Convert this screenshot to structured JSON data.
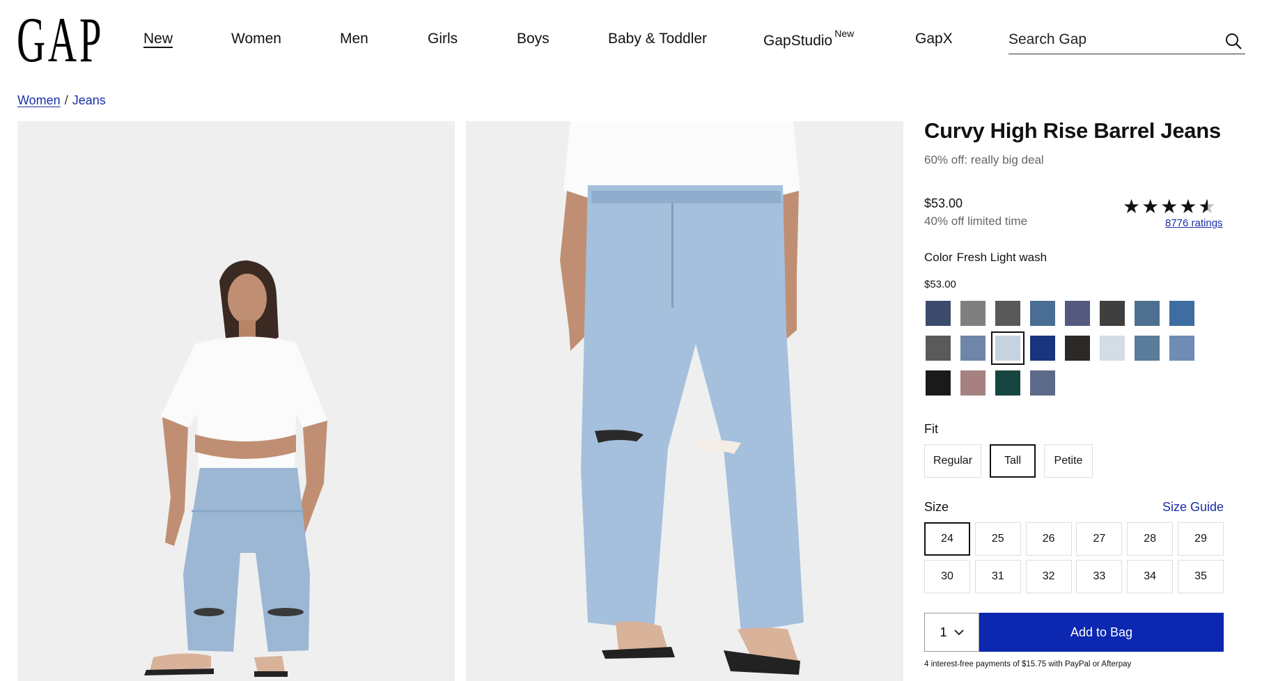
{
  "header": {
    "logo": "GAP",
    "nav": [
      {
        "label": "New",
        "active": true
      },
      {
        "label": "Women"
      },
      {
        "label": "Men"
      },
      {
        "label": "Girls"
      },
      {
        "label": "Boys"
      },
      {
        "label": "Baby & Toddler"
      },
      {
        "label": "GapStudio",
        "badge": "New"
      },
      {
        "label": "GapX"
      }
    ],
    "search_placeholder": "Search Gap",
    "search_icon": "search-icon"
  },
  "breadcrumb": {
    "parent": "Women",
    "separator": "/",
    "current": "Jeans"
  },
  "gallery": {
    "images": [
      "model-front-full",
      "jeans-closeup-front"
    ]
  },
  "product": {
    "title": "Curvy High Rise Barrel Jeans",
    "promo": "60% off: really big deal",
    "price": "$53.00",
    "discount_note": "40% off limited time",
    "rating_stars": "★★★★★",
    "rating_value": 4.5,
    "ratings_text": "8776 ratings",
    "color_label": "Color",
    "color_value": "Fresh Light wash",
    "swatch_price": "$53.00",
    "swatches": [
      "#3c4a6b",
      "#7f7f7f",
      "#595959",
      "#4a6d93",
      "#535a7e",
      "#3f3f3f",
      "#4e6f8f",
      "#3f6da0",
      "#5a5a5a",
      "#6f86a8",
      "#c7d3e0",
      "#1a347e",
      "#2b2828",
      "#d4dde5",
      "#5a7b99",
      "#6f8db4",
      "#1a1a1a",
      "#a58280",
      "#174540",
      "#5d6988"
    ],
    "selected_swatch": 10,
    "fit_label": "Fit",
    "fits": [
      "Regular",
      "Tall",
      "Petite"
    ],
    "selected_fit": "Tall",
    "size_label": "Size",
    "size_guide": "Size Guide",
    "sizes": [
      "24",
      "25",
      "26",
      "27",
      "28",
      "29",
      "30",
      "31",
      "32",
      "33",
      "34",
      "35"
    ],
    "selected_size": "24",
    "quantity": "1",
    "add_to_bag": "Add to Bag",
    "payment_note": "4 interest-free payments of $15.75 with PayPal or Afterpay"
  }
}
